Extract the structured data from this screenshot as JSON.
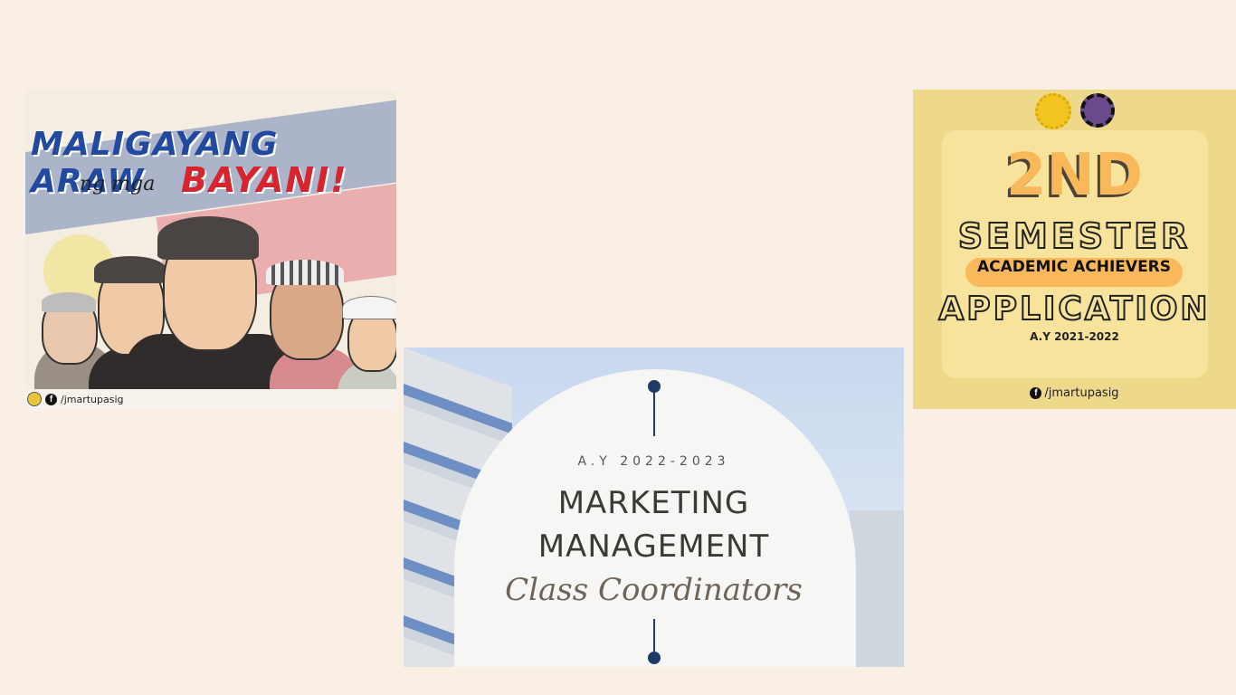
{
  "cards": [
    {
      "title_line1": "MALIGAYANG ARAW",
      "title_connector": "ng mga",
      "title_line2": "BAYANI!",
      "footer_handle": "/jmartupasig",
      "colors": {
        "title_blue": "#2149a0",
        "title_red": "#d7242e"
      }
    },
    {
      "academic_year": "A.Y 2022-2023",
      "line1": "MARKETING",
      "line2": "MANAGEMENT",
      "script_line": "Class Coordinators",
      "colors": {
        "accent": "#1f3a66"
      }
    },
    {
      "big_title": "2ND",
      "line2": "SEMESTER",
      "pill_text": "ACADEMIC ACHIEVERS",
      "line4": "APPLICATION",
      "academic_year": "A.Y 2021-2022",
      "footer_handle": "/jmartupasig",
      "colors": {
        "accent": "#f9b95a",
        "background": "#eed98a"
      }
    }
  ],
  "icons": {
    "facebook": "facebook-icon",
    "seal": "school-seal-icon"
  }
}
